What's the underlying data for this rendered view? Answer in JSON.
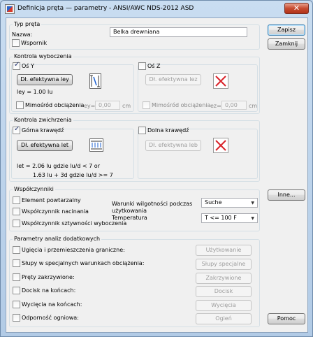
{
  "window": {
    "title": "Definicja pręta — parametry - ANSI/AWC NDS-2012 ASD",
    "close": "✕"
  },
  "typ": {
    "legend": "Typ pręta",
    "nazwa_label": "Nazwa:",
    "nazwa_value": "Belka drewniana",
    "wspornik_label": "Wspornik",
    "wspornik_checked": false
  },
  "buttons": {
    "zapisz": "Zapisz",
    "zamknij": "Zamknij",
    "inne": "Inne...",
    "pomoc": "Pomoc"
  },
  "wyboczenie": {
    "legend": "Kontrola wyboczenia",
    "y": {
      "label": "Oś Y",
      "checked": true,
      "button": "Dł. efektywna ley",
      "value": "ley = 1.00 lu",
      "mimosrod": "Mimośród obciążenia",
      "e_label": "ey=",
      "e_value": "0,00",
      "unit": "cm"
    },
    "z": {
      "label": "Oś Z",
      "checked": false,
      "button": "Dł. efektywna lez",
      "mimosrod": "Mimośród obciążenia",
      "e_label": "ez=",
      "e_value": "0,00",
      "unit": "cm"
    }
  },
  "zwichrzenie": {
    "legend": "Kontrola zwichrzenia",
    "gorna": {
      "label": "Górna krawędź",
      "checked": true,
      "button": "Dł. efektywna let",
      "line1": "let = 2.06 lu  gdzie lu/d < 7  or",
      "line2": "1.63 lu + 3d  gdzie lu/d >= 7"
    },
    "dolna": {
      "label": "Dolna krawędź",
      "checked": false,
      "button": "Dł. efektywna leb"
    }
  },
  "wspolczynniki": {
    "legend": "Współczynniki",
    "items": [
      "Element powtarzalny",
      "Współczynnik nacinania",
      "Współczynnik sztywności wyboczenia"
    ],
    "wilgotnosc_label": "Warunki wilgotności podczas użytkowania",
    "wilgotnosc_value": "Suche",
    "temperatura_label": "Temperatura",
    "temperatura_value": "T <= 100 F"
  },
  "analiza": {
    "legend": "Parametry analiz dodatkowych",
    "rows": [
      {
        "label": "Ugięcia i przemieszczenia graniczne:",
        "button": "Użytkowanie"
      },
      {
        "label": "Słupy w specjalnych warunkach obciążenia:",
        "button": "Słupy specjalne"
      },
      {
        "label": "Pręty zakrzywione:",
        "button": "Zakrzywione"
      },
      {
        "label": "Docisk na końcach:",
        "button": "Docisk"
      },
      {
        "label": "Wycięcia na końcach:",
        "button": "Wycięcia"
      },
      {
        "label": "Odporność ogniowa:",
        "button": "Ogień"
      }
    ]
  }
}
